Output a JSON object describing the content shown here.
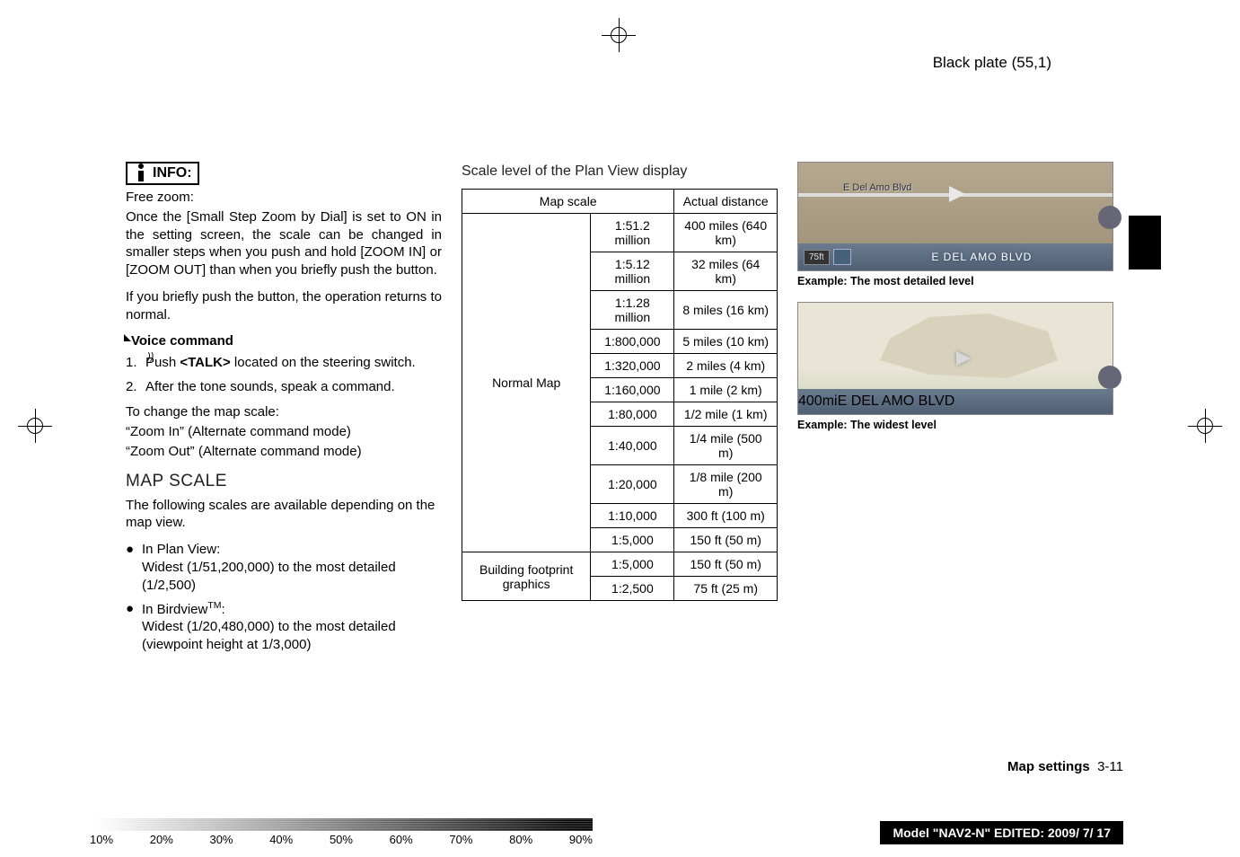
{
  "header": {
    "plate": "Black plate (55,1)"
  },
  "col1": {
    "info_label": "INFO:",
    "freezoom_title": "Free zoom:",
    "freezoom_body": "Once the [Small Step Zoom by Dial] is set to ON in the setting screen, the scale can be changed in smaller steps when you push and hold [ZOOM IN] or [ZOOM OUT] than when you briefly push the button.",
    "freezoom_body2": "If you briefly push the button, the operation returns to normal.",
    "voice_label": "Voice command",
    "step1_pre": "Push ",
    "step1_talk": "<TALK>",
    "step1_post": " located on the steering switch.",
    "step2": "After the tone sounds, speak a command.",
    "change_line": "To change the map scale:",
    "zoomin": "“Zoom In” (Alternate command mode)",
    "zoomout": "“Zoom Out” (Alternate command mode)",
    "h2_mapscale": "MAP SCALE",
    "scales_intro": "The following scales are available depending on the map view.",
    "plan_label": "In Plan View:",
    "plan_body": "Widest (1/51,200,000) to the most detailed (1/2,500)",
    "bird_label_pre": "In Birdview",
    "bird_label_sup": "TM",
    "bird_label_post": ":",
    "bird_body": "Widest (1/20,480,000) to the most detailed (viewpoint height at 1/3,000)"
  },
  "col2": {
    "h3": "Scale level of the Plan View display",
    "th_mapscale": "Map scale",
    "th_actual": "Actual distance",
    "normal_label": "Normal Map",
    "building_label": "Building footprint graphics",
    "rows": [
      {
        "scale": "1:51.2 million",
        "dist": "400 miles (640 km)"
      },
      {
        "scale": "1:5.12 million",
        "dist": "32 miles (64 km)"
      },
      {
        "scale": "1:1.28 million",
        "dist": "8 miles (16 km)"
      },
      {
        "scale": "1:800,000",
        "dist": "5 miles (10 km)"
      },
      {
        "scale": "1:320,000",
        "dist": "2 miles (4 km)"
      },
      {
        "scale": "1:160,000",
        "dist": "1 mile (2 km)"
      },
      {
        "scale": "1:80,000",
        "dist": "1/2 mile (1 km)"
      },
      {
        "scale": "1:40,000",
        "dist": "1/4 mile (500 m)"
      },
      {
        "scale": "1:20,000",
        "dist": "1/8 mile (200 m)"
      },
      {
        "scale": "1:10,000",
        "dist": "300 ft (100 m)"
      },
      {
        "scale": "1:5,000",
        "dist": "150 ft (50 m)"
      }
    ],
    "brows": [
      {
        "scale": "1:5,000",
        "dist": "150 ft (50 m)"
      },
      {
        "scale": "1:2,500",
        "dist": "75 ft (25 m)"
      }
    ]
  },
  "col3": {
    "map1_roadlabel": "E Del Amo Blvd",
    "map1_scale": "75ft",
    "map1_street": "E DEL AMO BLVD",
    "cap1": "Example: The most detailed level",
    "map2_scale": "400mi",
    "map2_street": "E DEL AMO BLVD",
    "cap2": "Example: The widest level"
  },
  "footer": {
    "section_label": "Map settings",
    "page": "3-11",
    "model_pre": "Model ",
    "model_quote": "\"",
    "model_name": "NAV2-N",
    "model_post": " EDITED: 2009/ 7/ 17"
  },
  "gradient_labels": [
    "10%",
    "20%",
    "30%",
    "40%",
    "50%",
    "60%",
    "70%",
    "80%",
    "90%"
  ]
}
